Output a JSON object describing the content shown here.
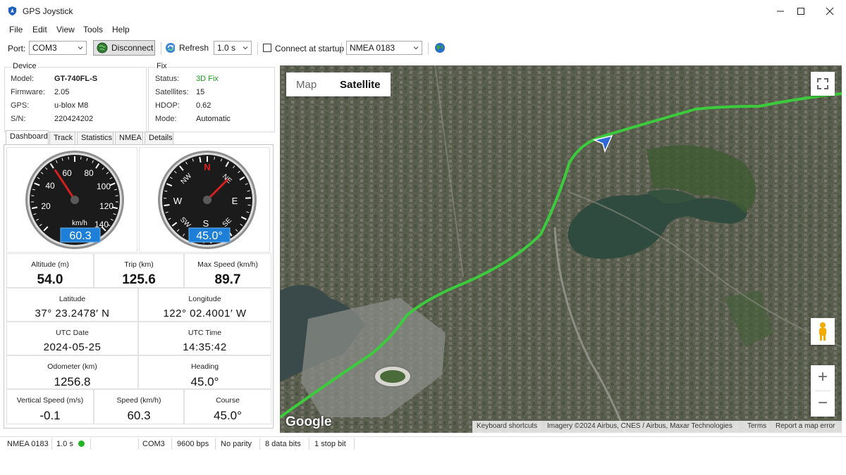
{
  "window": {
    "title": "GPS Joystick"
  },
  "menu": [
    "File",
    "Edit",
    "View",
    "Tools",
    "Help"
  ],
  "toolbar": {
    "port_label": "Port:",
    "port_value": "COM3",
    "disconnect_label": "Disconnect",
    "refresh_label": "Refresh",
    "interval_value": "1.0 s",
    "connect_startup_label": "Connect at startup",
    "connect_startup_checked": false,
    "protocol_value": "NMEA 0183"
  },
  "device": {
    "header": "Device",
    "rows": [
      {
        "key": "Model:",
        "value": "GT-740FL-S"
      },
      {
        "key": "Firmware:",
        "value": "2.05"
      },
      {
        "key": "GPS:",
        "value": "u-blox M8"
      },
      {
        "key": "S/N:",
        "value": "220424202"
      }
    ]
  },
  "fix": {
    "header": "Fix",
    "rows": [
      {
        "key": "Status:",
        "value": "3D Fix"
      },
      {
        "key": "Satellites:",
        "value": "15"
      },
      {
        "key": "HDOP:",
        "value": "0.62"
      },
      {
        "key": "Mode:",
        "value": "Automatic"
      }
    ],
    "status_color": "#1a9c1a"
  },
  "tabs": [
    "Dashboard",
    "Track",
    "Statistics",
    "NMEA",
    "Details"
  ],
  "active_tab": "Dashboard",
  "speedometer": {
    "ticks": [
      "20",
      "40",
      "60",
      "80",
      "100",
      "120",
      "140"
    ],
    "unit": "km/h",
    "readout": "60.3",
    "value": 60.3
  },
  "compass": {
    "labels": [
      "N",
      "NE",
      "E",
      "SE",
      "S",
      "SW",
      "W",
      "NW"
    ],
    "readout": "45.0°",
    "heading": 45.0
  },
  "metrics": {
    "altitude": {
      "label": "Altitude (m)",
      "value": "54.0"
    },
    "trip": {
      "label": "Trip (km)",
      "value": "125.6"
    },
    "max_speed": {
      "label": "Max Speed (km/h)",
      "value": "89.7"
    },
    "latitude": {
      "label": "Latitude",
      "value": "37° 23.2478′ N"
    },
    "longitude": {
      "label": "Longitude",
      "value": "122° 02.4001′ W"
    },
    "utc_date": {
      "label": "UTC Date",
      "value": "2024-05-25"
    },
    "utc_time": {
      "label": "UTC Time",
      "value": "14:35:42"
    },
    "odometer": {
      "label": "Odometer (km)",
      "value": "1256.8"
    },
    "heading": {
      "label": "Heading",
      "value": "45.0°"
    },
    "vertical_speed": {
      "label": "Vertical Speed (m/s)",
      "value": "-0.1"
    },
    "speed": {
      "label": "Speed (km/h)",
      "value": "60.3"
    },
    "course": {
      "label": "Course",
      "value": "45.0°"
    }
  },
  "map": {
    "type_map": "Map",
    "type_satellite": "Satellite",
    "active_type": "Satellite",
    "logo": "Google",
    "attribution": [
      "Keyboard shortcuts",
      "Imagery ©2024 Airbus, CNES / Airbus, Maxar Technologies",
      "Terms",
      "Report a map error"
    ],
    "zoom_in": "+",
    "zoom_out": "−",
    "track_color": "#3ccb3c"
  },
  "status": {
    "protocol": "NMEA 0183",
    "interval": "1.0 s",
    "port": "COM3",
    "baud": "9600 bps",
    "parity": "No parity",
    "data_bits": "8 data bits",
    "stop_bits": "1 stop bit",
    "indicator_color": "#22b422"
  }
}
